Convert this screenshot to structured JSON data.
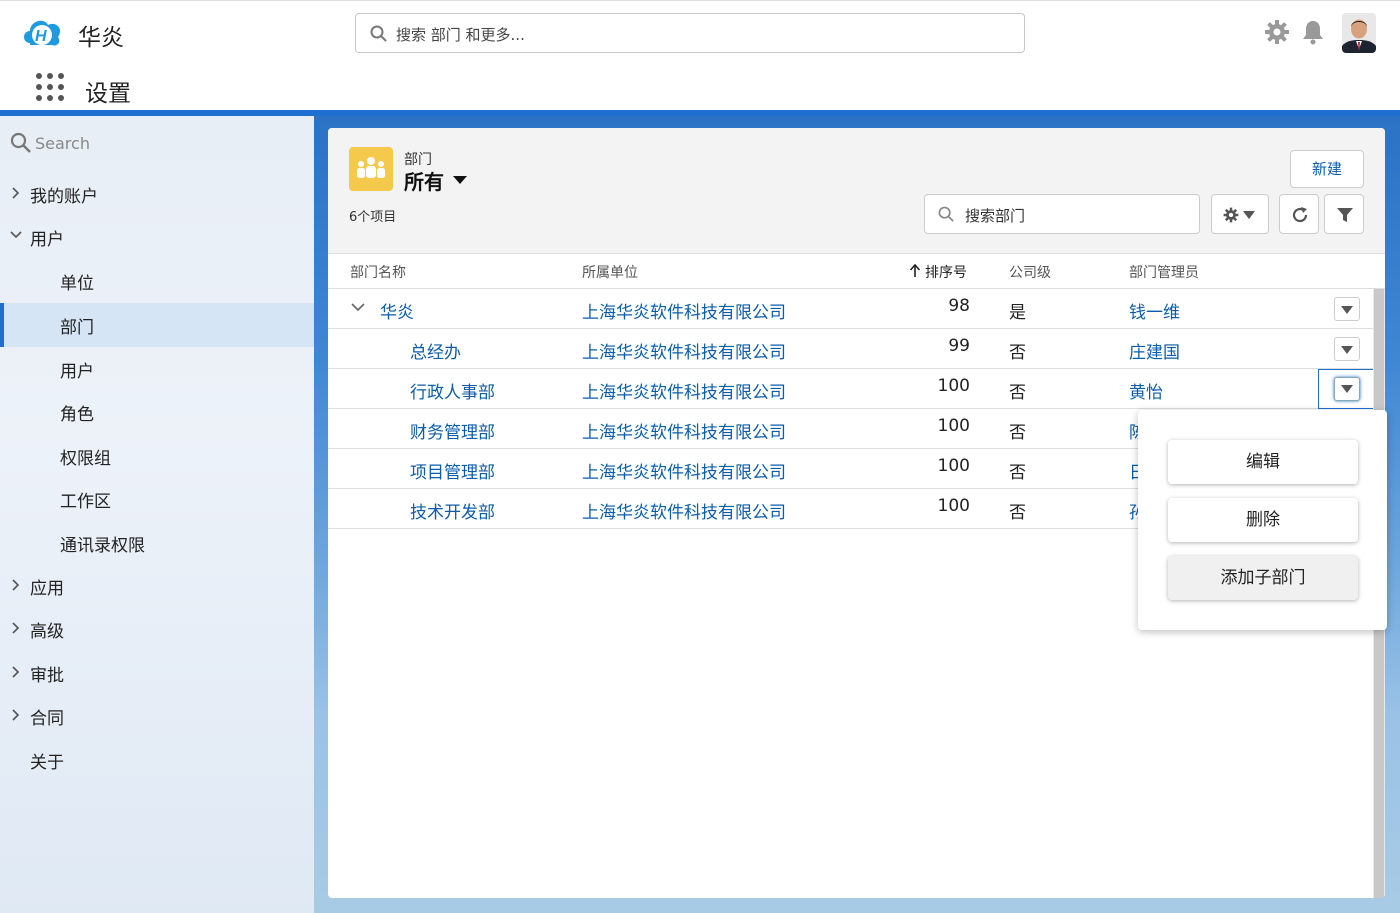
{
  "header": {
    "brand": "华炎",
    "search_placeholder": "搜索 部门 和更多...",
    "app_name": "设置"
  },
  "sidebar": {
    "search_placeholder": "Search",
    "items": [
      {
        "label": "我的账户",
        "expandable": true,
        "expanded": false,
        "level": 0
      },
      {
        "label": "用户",
        "expandable": true,
        "expanded": true,
        "level": 0
      },
      {
        "label": "单位",
        "level": 1
      },
      {
        "label": "部门",
        "level": 1,
        "active": true
      },
      {
        "label": "用户",
        "level": 1
      },
      {
        "label": "角色",
        "level": 1
      },
      {
        "label": "权限组",
        "level": 1
      },
      {
        "label": "工作区",
        "level": 1
      },
      {
        "label": "通讯录权限",
        "level": 1
      },
      {
        "label": "应用",
        "expandable": true,
        "expanded": false,
        "level": 0
      },
      {
        "label": "高级",
        "expandable": true,
        "expanded": false,
        "level": 0
      },
      {
        "label": "审批",
        "expandable": true,
        "expanded": false,
        "level": 0
      },
      {
        "label": "合同",
        "expandable": true,
        "expanded": false,
        "level": 0
      },
      {
        "label": "关于",
        "expandable": false,
        "level": 0
      }
    ]
  },
  "list": {
    "object_label": "部门",
    "view_name": "所有",
    "count_text": "6个项目",
    "new_button": "新建",
    "search_placeholder": "搜索部门",
    "columns": [
      "部门名称",
      "所属单位",
      "排序号",
      "公司级",
      "部门管理员"
    ],
    "rows": [
      {
        "name": "华炎",
        "unit": "上海华炎软件科技有限公司",
        "sort": "98",
        "company": "是",
        "manager": "钱一维"
      },
      {
        "name": "总经办",
        "unit": "上海华炎软件科技有限公司",
        "sort": "99",
        "company": "否",
        "manager": "庄建国"
      },
      {
        "name": "行政人事部",
        "unit": "上海华炎软件科技有限公司",
        "sort": "100",
        "company": "否",
        "manager": "黄怡"
      },
      {
        "name": "财务管理部",
        "unit": "上海华炎软件科技有限公司",
        "sort": "100",
        "company": "否",
        "manager": "陈"
      },
      {
        "name": "项目管理部",
        "unit": "上海华炎软件科技有限公司",
        "sort": "100",
        "company": "否",
        "manager": "日"
      },
      {
        "name": "技术开发部",
        "unit": "上海华炎软件科技有限公司",
        "sort": "100",
        "company": "否",
        "manager": "孙"
      }
    ]
  },
  "row_menu": {
    "items": [
      "编辑",
      "删除",
      "添加子部门"
    ]
  },
  "colors": {
    "accent": "#1f6fd1",
    "link": "#0b5cad",
    "object_icon": "#f5c94c"
  }
}
